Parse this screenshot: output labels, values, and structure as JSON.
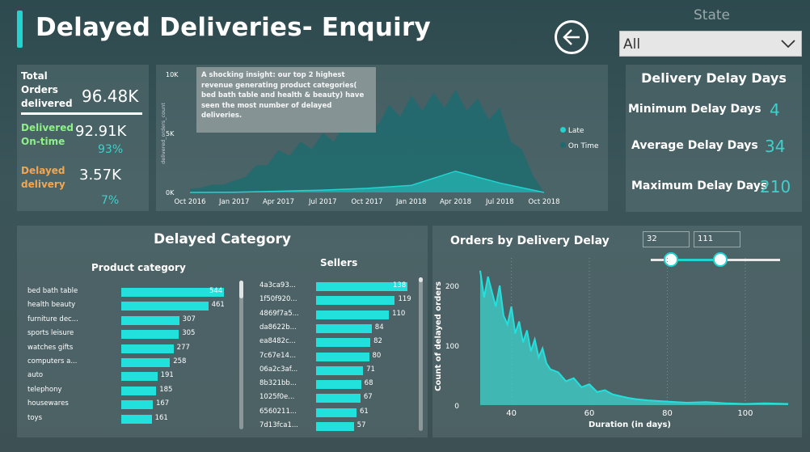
{
  "header": {
    "title": "Delayed Deliveries- Enquiry",
    "state_label": "State",
    "state_value": "All"
  },
  "kpis": {
    "total_label": "Total Orders delivered",
    "total_value": "96.48K",
    "ontime_label": "Delivered On-time",
    "ontime_value": "92.91K",
    "ontime_pct": "93%",
    "delayed_label": "Delayed delivery",
    "delayed_value": "3.57K",
    "delayed_pct": "7%",
    "ontime_color": "#8ff08a",
    "delayed_color": "#f4a64e"
  },
  "timeline": {
    "tooltip": "A shocking insight: our top 2 highest revenue generating product categories( bed bath table and health & beauty) have seen the most number of delayed deliveries.",
    "ylabel": "delivered_orders_count",
    "yticks": [
      "10K",
      "5K",
      "0K"
    ],
    "xticks": [
      "Oct 2016",
      "Jan 2017",
      "Apr 2017",
      "Jul 2017",
      "Oct 2017",
      "Jan 2018",
      "Apr 2018",
      "Jul 2018",
      "Oct 2018"
    ],
    "legend": [
      {
        "name": "Late",
        "color": "#22d3cf"
      },
      {
        "name": "On Time",
        "color": "#1e6b6f"
      }
    ]
  },
  "delay_days": {
    "title": "Delivery Delay Days",
    "min_label": "Minimum Delay Days",
    "min_value": "4",
    "avg_label": "Average Delay Days",
    "avg_value": "34",
    "max_label": "Maximum Delay Days",
    "max_value": "210"
  },
  "delayed_category": {
    "title": "Delayed Category",
    "product_header": "Product category",
    "sellers_header": "Sellers",
    "products": [
      {
        "label": "bed bath table",
        "value": 544
      },
      {
        "label": "health beauty",
        "value": 461
      },
      {
        "label": "furniture dec...",
        "value": 307
      },
      {
        "label": "sports leisure",
        "value": 305
      },
      {
        "label": "watches gifts",
        "value": 277
      },
      {
        "label": "computers a...",
        "value": 258
      },
      {
        "label": "auto",
        "value": 191
      },
      {
        "label": "telephony",
        "value": 185
      },
      {
        "label": "housewares",
        "value": 167
      },
      {
        "label": "toys",
        "value": 161
      }
    ],
    "sellers": [
      {
        "label": "4a3ca93...",
        "value": 138
      },
      {
        "label": "1f50f920...",
        "value": 119
      },
      {
        "label": "4869f7a5...",
        "value": 110
      },
      {
        "label": "da8622b...",
        "value": 84
      },
      {
        "label": "ea8482c...",
        "value": 82
      },
      {
        "label": "7c67e14...",
        "value": 80
      },
      {
        "label": "06a2c3af...",
        "value": 71
      },
      {
        "label": "8b321bb...",
        "value": 68
      },
      {
        "label": "1025f0e...",
        "value": 67
      },
      {
        "label": "6560211...",
        "value": 61
      },
      {
        "label": "7d13fca1...",
        "value": 57
      }
    ]
  },
  "orders_by_delay": {
    "title": "Orders by Delivery Delay",
    "slider_min": "32",
    "slider_max": "111",
    "ylabel": "Count of delayed orders",
    "xlabel": "Duration (in days)",
    "yticks": [
      "200",
      "100",
      "0"
    ],
    "xticks": [
      "40",
      "60",
      "80",
      "100"
    ]
  },
  "chart_data": [
    {
      "type": "area",
      "title": "",
      "ylabel": "delivered_orders_count",
      "ylim": [
        0,
        10000
      ],
      "x": [
        "Oct 2016",
        "Jan 2017",
        "Apr 2017",
        "Jul 2017",
        "Oct 2017",
        "Jan 2018",
        "Apr 2018",
        "Jul 2018",
        "Oct 2018"
      ],
      "series": [
        {
          "name": "On Time",
          "values": [
            300,
            900,
            3200,
            4500,
            6000,
            7500,
            8000,
            6500,
            0
          ]
        },
        {
          "name": "Late",
          "values": [
            0,
            20,
            100,
            200,
            350,
            600,
            1800,
            800,
            0
          ]
        }
      ]
    },
    {
      "type": "bar",
      "title": "Product category",
      "categories": [
        "bed bath table",
        "health beauty",
        "furniture dec...",
        "sports leisure",
        "watches gifts",
        "computers a...",
        "auto",
        "telephony",
        "housewares",
        "toys"
      ],
      "values": [
        544,
        461,
        307,
        305,
        277,
        258,
        191,
        185,
        167,
        161
      ]
    },
    {
      "type": "bar",
      "title": "Sellers",
      "categories": [
        "4a3ca93...",
        "1f50f920...",
        "4869f7a5...",
        "da8622b...",
        "ea8482c...",
        "7c67e14...",
        "06a2c3af...",
        "8b321bb...",
        "1025f0e...",
        "6560211...",
        "7d13fca1..."
      ],
      "values": [
        138,
        119,
        110,
        84,
        82,
        80,
        71,
        68,
        67,
        61,
        57
      ]
    },
    {
      "type": "area",
      "title": "Orders by Delivery Delay",
      "xlabel": "Duration (in days)",
      "ylabel": "Count of delayed orders",
      "xlim": [
        32,
        111
      ],
      "ylim": [
        0,
        230
      ],
      "x": [
        32,
        33,
        34,
        35,
        36,
        37,
        38,
        39,
        40,
        41,
        42,
        43,
        44,
        45,
        46,
        47,
        48,
        49,
        50,
        52,
        54,
        56,
        58,
        60,
        62,
        64,
        66,
        68,
        70,
        72,
        75,
        80,
        85,
        90,
        95,
        100,
        105,
        111
      ],
      "values": [
        225,
        180,
        215,
        190,
        165,
        200,
        150,
        135,
        165,
        120,
        140,
        105,
        125,
        90,
        110,
        80,
        95,
        70,
        60,
        55,
        40,
        45,
        30,
        35,
        22,
        25,
        18,
        15,
        12,
        10,
        8,
        6,
        4,
        5,
        3,
        2,
        3,
        2
      ]
    }
  ]
}
